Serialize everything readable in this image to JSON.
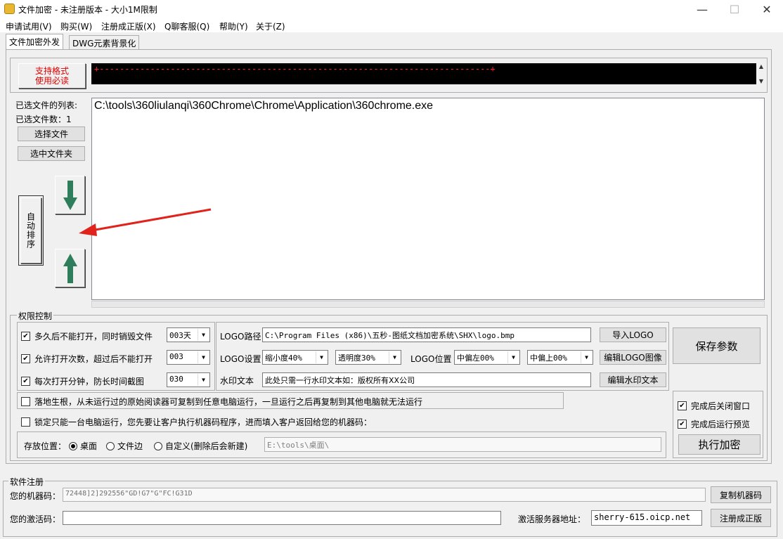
{
  "window": {
    "title": "文件加密 - 未注册版本 - 大小1M限制",
    "controls": {
      "minimize": "—",
      "maximize": "☐",
      "close": "✕"
    }
  },
  "menu": [
    "申请试用(V)",
    "购买(W)",
    "注册成正版(X)",
    "Q聊客服(Q)",
    "帮助(Y)",
    "关于(Z)"
  ],
  "tabs": [
    "文件加密外发",
    "DWG元素背景化"
  ],
  "support_button": {
    "line1": "支持格式",
    "line2": "使用必读"
  },
  "marquee_text": "+-----------------------------------------------------------------------------+",
  "file_list": {
    "label": "已选文件的列表:",
    "count_label": "已选文件数：1",
    "select_file": "选择文件",
    "select_folder": "选中文件夹",
    "items": [
      "C:\\tools\\360liulanqi\\360Chrome\\Chrome\\Application\\360chrome.exe"
    ]
  },
  "sort_button": "自动排序",
  "permissions": {
    "group_title": "权限控制",
    "rows": [
      {
        "label": "多久后不能打开，同时销毁文件",
        "checked": true,
        "value": "003天"
      },
      {
        "label": "允许打开次数，超过后不能打开",
        "checked": true,
        "value": "003"
      },
      {
        "label": "每次打开分钟，防长时间截图",
        "checked": true,
        "value": "030"
      }
    ],
    "logo_path_label": "LOGO路径",
    "logo_path": "C:\\Program Files (x86)\\五秒-图纸文档加密系统\\SHX\\logo.bmp",
    "import_logo": "导入LOGO",
    "logo_settings_label": "LOGO设置",
    "scale": "缩小度40%",
    "opacity": "透明度30%",
    "logo_position_label": "LOGO位置",
    "pos_h": "中偏左00%",
    "pos_v": "中偏上00%",
    "edit_logo": "编辑LOGO图像",
    "watermark_label": "水印文本",
    "watermark_text": "此处只需一行水印文本如：版权所有XX公司",
    "edit_watermark": "编辑水印文本",
    "save_params": "保存参数",
    "root_option": {
      "label": "落地生根，从未运行过的原始阅读器可复制到任意电脑运行，一旦运行之后再复制到其他电脑就无法运行",
      "checked": false
    },
    "lock_option": {
      "label": "锁定只能一台电脑运行，您先要让客户执行机器码程序，进而填入客户返回给您的机器码：",
      "checked": false
    },
    "storage_label": "存放位置：",
    "storage_options": [
      "桌面",
      "文件边",
      "自定义(删除后会新建)"
    ],
    "storage_selected": "桌面",
    "storage_path": "E:\\tools\\桌面\\",
    "close_after": {
      "label": "完成后关闭窗口",
      "checked": true
    },
    "preview_after": {
      "label": "完成后运行预览",
      "checked": true
    },
    "execute": "执行加密"
  },
  "registration": {
    "group_title": "软件注册",
    "machine_label": "您的机器码：",
    "machine_code": "72448]2]292556\"GD!G7\"G\"FC!G31D",
    "copy_machine": "复制机器码",
    "activation_label": "您的激活码：",
    "activation_code": "",
    "server_label": "激活服务器地址：",
    "server": "sherry-615.oicp.net",
    "register": "注册成正版"
  },
  "colors": {
    "marquee_bg": "#000000",
    "marquee_fg": "#ff2020",
    "support_text": "#e00000",
    "arrow_green": "#2e7d5b",
    "annotation_arrow": "#e0231c"
  }
}
